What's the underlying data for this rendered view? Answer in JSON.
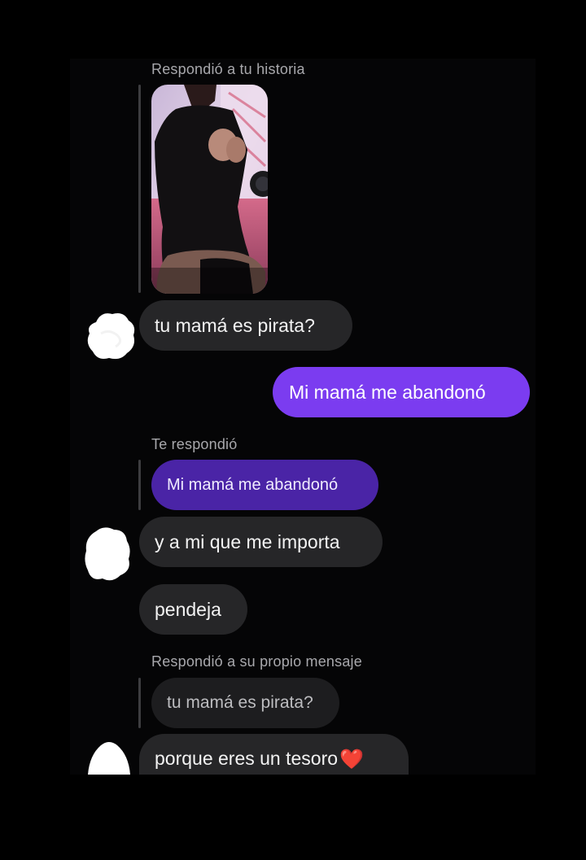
{
  "colors": {
    "background": "#000000",
    "incoming_bubble": "#262628",
    "outgoing_bubble": "#7b3cf0",
    "quoted_own_bubble": "#4a24a6",
    "quoted_gray_bubble": "#1d1d1f",
    "context_text": "#a8a8ac"
  },
  "conversation": {
    "story_reply_label": "Respondió a tu historia",
    "msg_1": "tu mamá es pirata?",
    "msg_2_sent": "Mi mamá me abandonó",
    "reply_label": "Te respondió",
    "quoted_sent": "Mi mamá me abandonó",
    "msg_3": "y a mi que me importa",
    "msg_4": "pendeja",
    "self_reply_label": "Respondió a su propio mensaje",
    "quoted_self": "tu mamá es pirata?",
    "msg_5": "porque eres un tesoro",
    "msg_5_emoji": "❤️"
  }
}
